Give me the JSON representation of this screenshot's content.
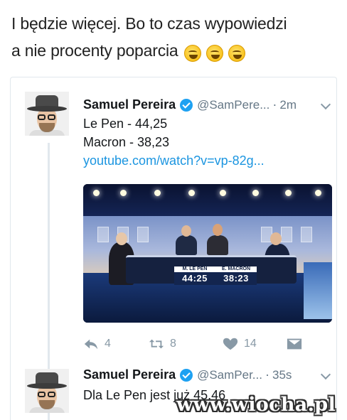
{
  "caption": {
    "line1": "I będzie więcej. Bo to czas wypowiedzi",
    "line2": "a nie procenty poparcia"
  },
  "tweets": [
    {
      "name": "Samuel Pereira",
      "handle": "@SamPere...",
      "time": "2m",
      "lines": [
        "Le Pen - 44,25",
        "Macron - 38,23"
      ],
      "link": "youtube.com/watch?v=vp-82g...",
      "media": {
        "score_left_label": "M. LE PEN",
        "score_left_value": "44:25",
        "score_right_label": "E. MACRON",
        "score_right_value": "38:23"
      },
      "actions": {
        "reply_count": "4",
        "retweet_count": "8",
        "like_count": "14"
      }
    },
    {
      "name": "Samuel Pereira",
      "handle": "@SamPer...",
      "time": "35s",
      "text": "Dla Le Pen jest już 45,46"
    }
  ],
  "watermark": "www.wiocha.pl",
  "colors": {
    "link": "#1b95e0",
    "verified": "#1da1f2",
    "muted": "#8899a6"
  },
  "icons": [
    "laughing-emoji-icon",
    "verified-badge-icon",
    "chevron-down-icon",
    "reply-icon",
    "retweet-icon",
    "like-icon",
    "direct-message-icon"
  ]
}
